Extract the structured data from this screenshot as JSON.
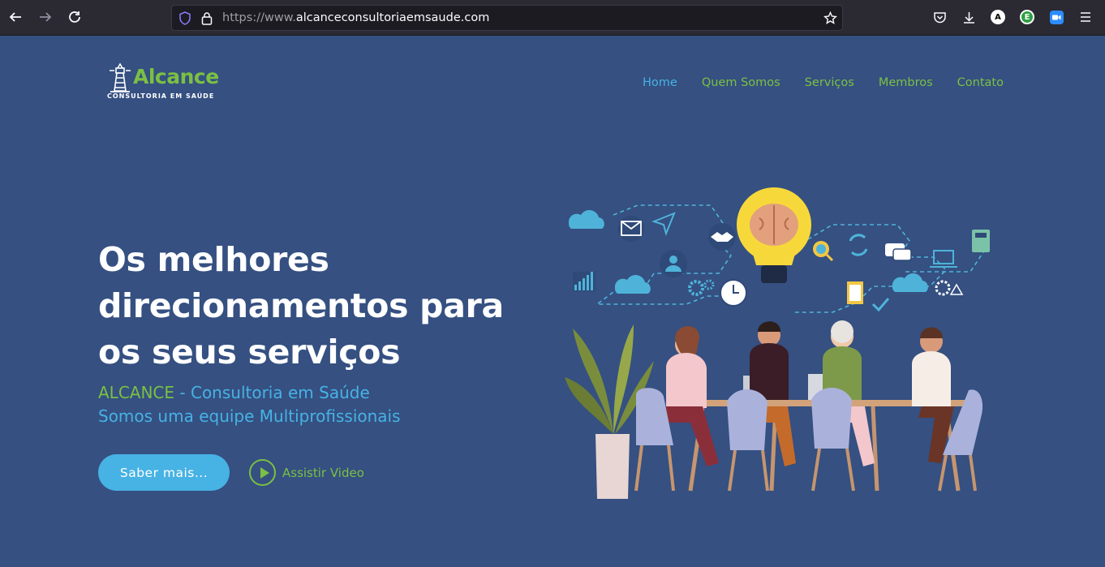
{
  "browser": {
    "url_prefix": "https://www.",
    "url_domain": "alcanceconsultoriaemsaude.com",
    "extensions": [
      {
        "name": "a-extension",
        "letter": "A",
        "color": "#ffffff",
        "text": "#000000"
      },
      {
        "name": "e-extension",
        "letter": "E",
        "color": "#2e9e44",
        "text": "#ffffff"
      }
    ]
  },
  "logo": {
    "word": "Alcance",
    "subtitle": "CONSULTORIA EM SAÚDE"
  },
  "nav": {
    "items": [
      "Home",
      "Quem Somos",
      "Serviços",
      "Membros",
      "Contato"
    ],
    "active": "Home"
  },
  "hero": {
    "title": "Os melhores direcionamentos para os seus serviços",
    "brand": "ALCANCE",
    "tagline": " - Consultoria em Saúde",
    "subtitle2": "Somos uma equipe Multiprofissionais",
    "primary_button": "Saber mais...",
    "video_button": "Assistir Video"
  },
  "colors": {
    "background": "#355081",
    "accent_green": "#7bc043",
    "accent_blue": "#47b2e4"
  }
}
